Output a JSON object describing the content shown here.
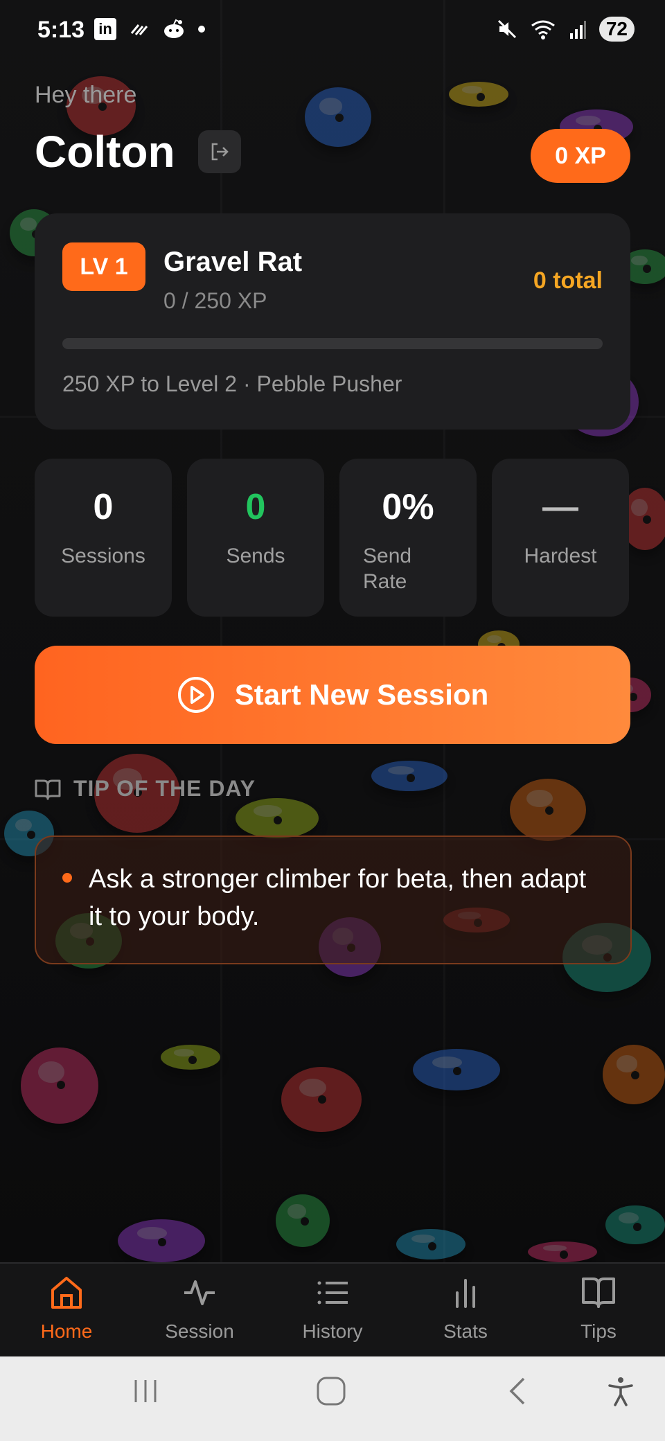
{
  "status_bar": {
    "time": "5:13",
    "battery": "72"
  },
  "header": {
    "greeting": "Hey there",
    "user_name": "Colton",
    "xp_badge": "0 XP"
  },
  "level_card": {
    "level_badge": "LV 1",
    "rank_name": "Gravel Rat",
    "xp_progress": "0 / 250 XP",
    "total": "0 total",
    "progress_fraction": 0,
    "next_level": "250 XP to Level 2 · Pebble Pusher"
  },
  "stats": [
    {
      "value": "0",
      "label": "Sessions",
      "value_color": "#ffffff"
    },
    {
      "value": "0",
      "label": "Sends",
      "value_color": "#22c55e"
    },
    {
      "value": "0%",
      "label": "Send Rate",
      "value_color": "#ffffff"
    },
    {
      "value": "—",
      "label": "Hardest",
      "value_color": "#ffffff"
    }
  ],
  "start_button": {
    "label": "Start New Session"
  },
  "tip": {
    "heading": "TIP OF THE DAY",
    "text": "Ask a stronger climber for beta, then adapt it to your body."
  },
  "nav": {
    "items": [
      {
        "label": "Home",
        "icon": "home-icon",
        "active": true
      },
      {
        "label": "Session",
        "icon": "activity-icon",
        "active": false
      },
      {
        "label": "History",
        "icon": "list-icon",
        "active": false
      },
      {
        "label": "Stats",
        "icon": "bar-chart-icon",
        "active": false
      },
      {
        "label": "Tips",
        "icon": "book-icon",
        "active": false
      }
    ]
  },
  "colors": {
    "accent": "#ff6a1a",
    "gold": "#f5a623",
    "success": "#22c55e",
    "card": "#1e1e20"
  }
}
